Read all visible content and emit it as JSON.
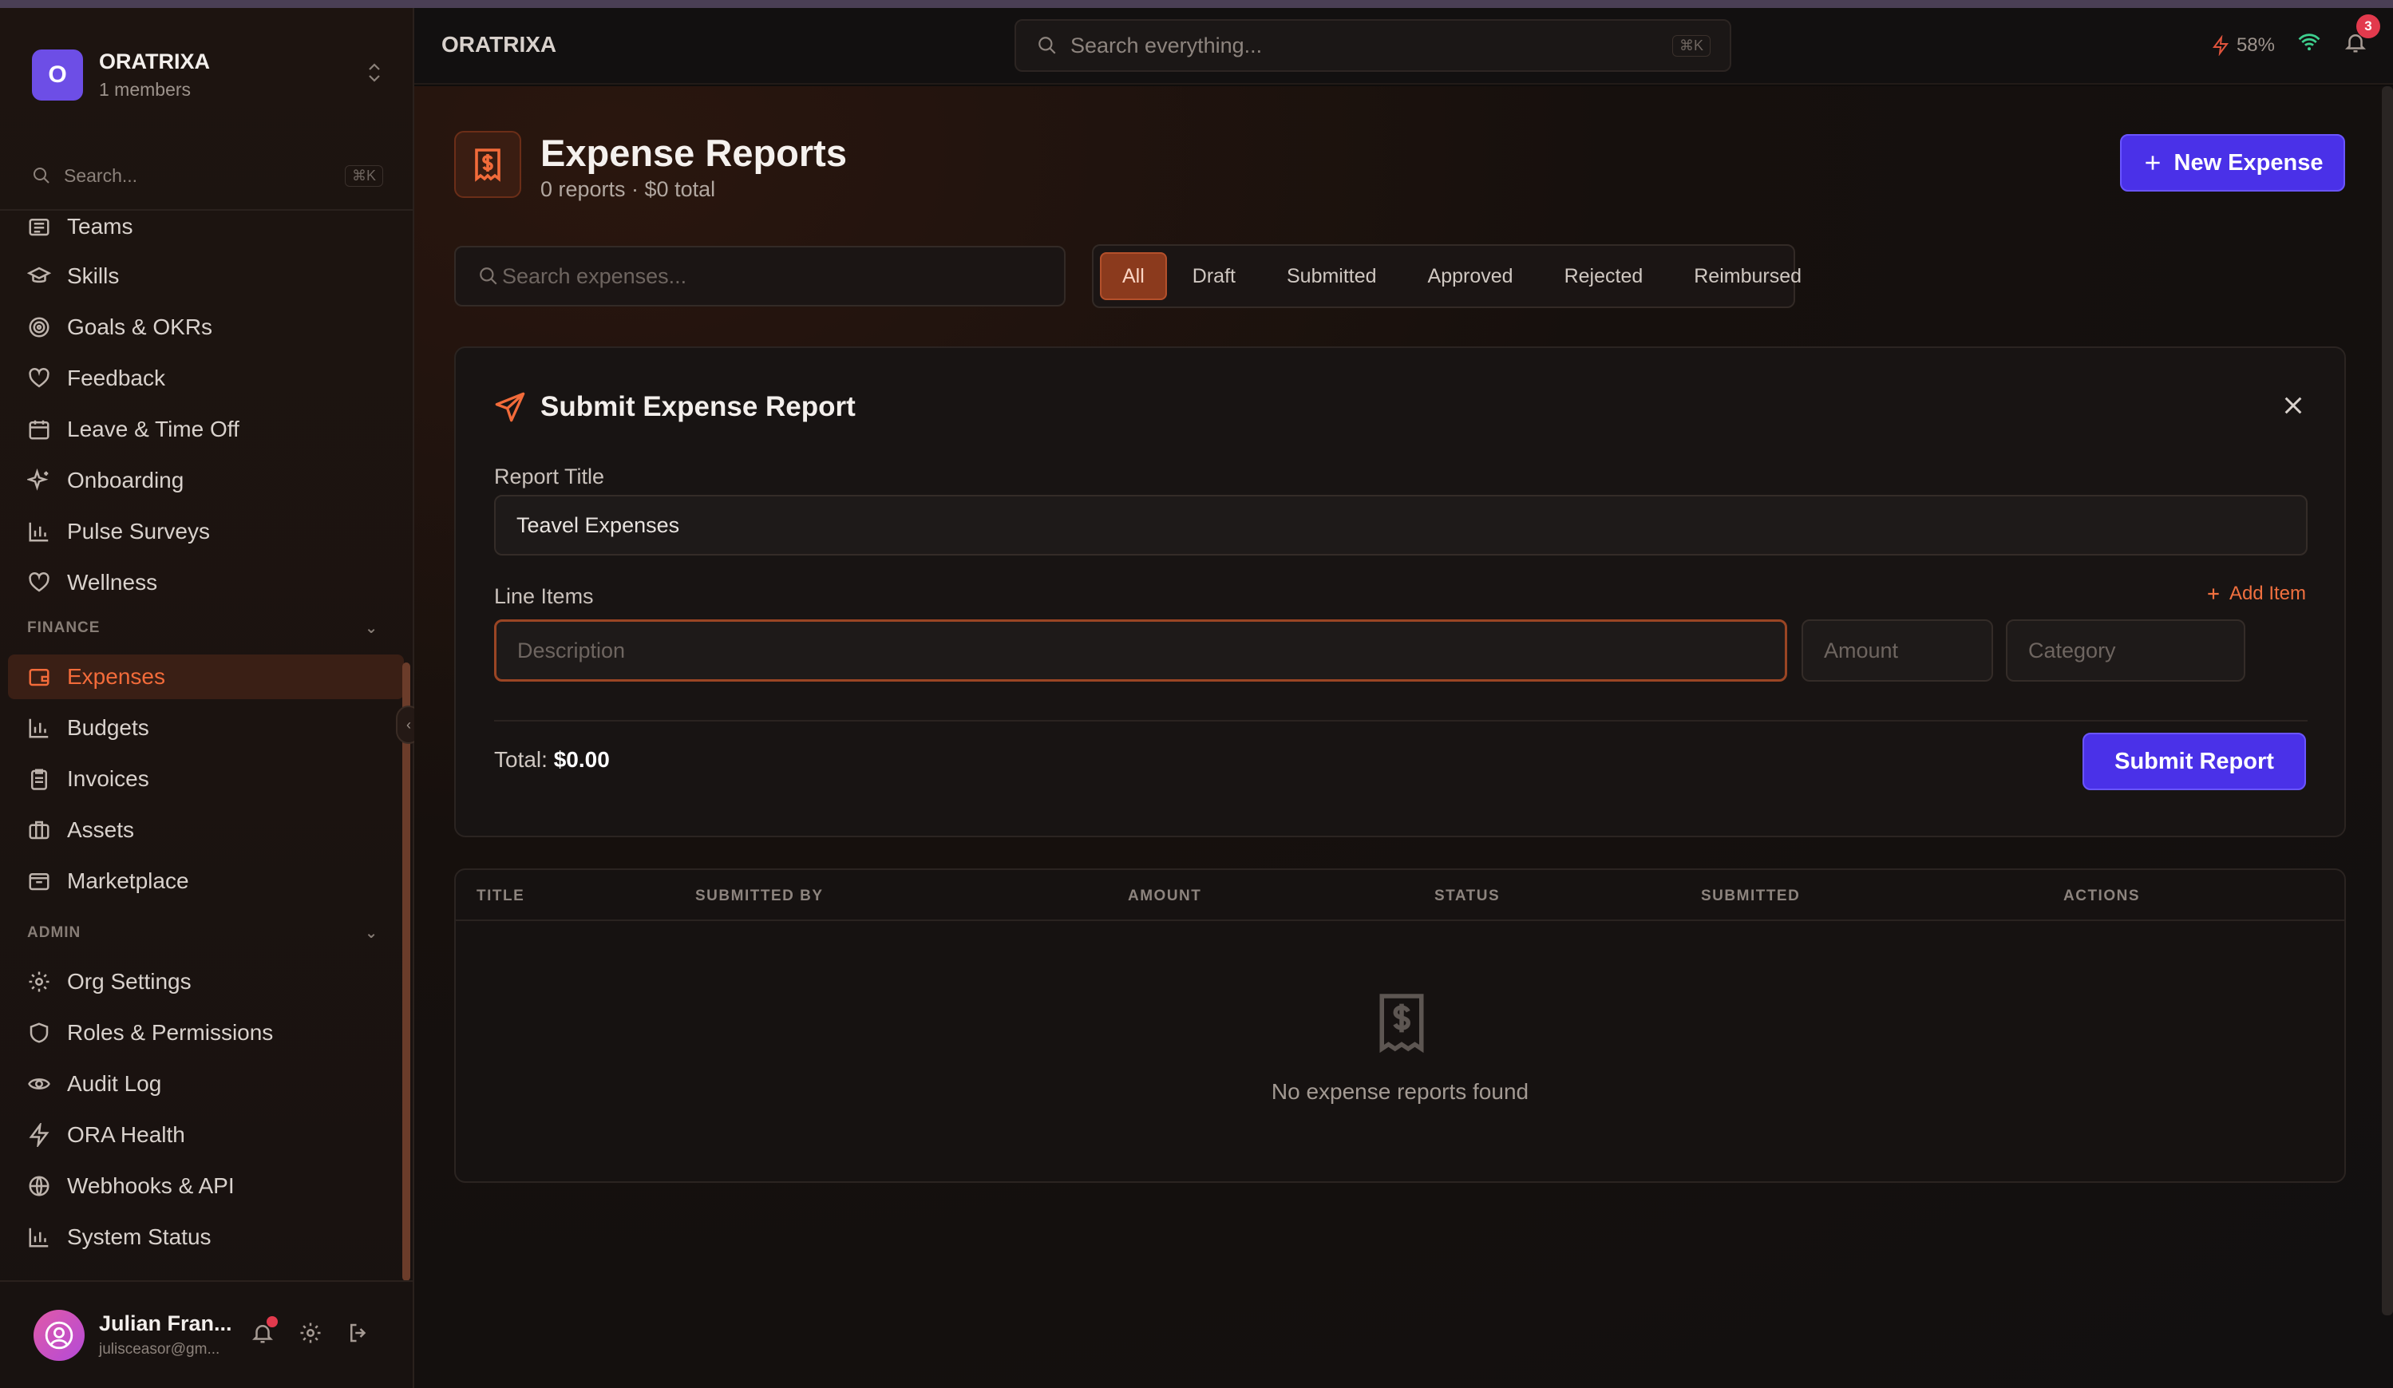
{
  "org": {
    "initial": "O",
    "name": "ORATRIXA",
    "members": "1 members"
  },
  "sidebar": {
    "search_placeholder": "Search...",
    "search_shortcut": "⌘K",
    "items": [
      {
        "label": "Teams",
        "icon": "teams-icon"
      },
      {
        "label": "Skills",
        "icon": "graduation-cap-icon"
      },
      {
        "label": "Goals & OKRs",
        "icon": "target-icon"
      },
      {
        "label": "Feedback",
        "icon": "heart-icon"
      },
      {
        "label": "Leave & Time Off",
        "icon": "calendar-icon"
      },
      {
        "label": "Onboarding",
        "icon": "sparkles-icon"
      },
      {
        "label": "Pulse Surveys",
        "icon": "bar-chart-icon"
      },
      {
        "label": "Wellness",
        "icon": "heart-icon"
      }
    ],
    "finance_label": "FINANCE",
    "finance_items": [
      {
        "label": "Expenses",
        "icon": "wallet-icon",
        "active": true
      },
      {
        "label": "Budgets",
        "icon": "bar-chart-icon"
      },
      {
        "label": "Invoices",
        "icon": "clipboard-icon"
      },
      {
        "label": "Assets",
        "icon": "briefcase-icon"
      },
      {
        "label": "Marketplace",
        "icon": "package-icon"
      }
    ],
    "admin_label": "ADMIN",
    "admin_items": [
      {
        "label": "Org Settings",
        "icon": "gear-icon"
      },
      {
        "label": "Roles & Permissions",
        "icon": "shield-icon"
      },
      {
        "label": "Audit Log",
        "icon": "eye-icon"
      },
      {
        "label": "ORA Health",
        "icon": "zap-icon"
      },
      {
        "label": "Webhooks & API",
        "icon": "globe-icon"
      },
      {
        "label": "System Status",
        "icon": "bar-chart-icon"
      }
    ]
  },
  "user": {
    "name": "Julian Fran...",
    "email": "julisceasor@gm..."
  },
  "topbar": {
    "title": "ORATRIXA",
    "search_placeholder": "Search everything...",
    "search_shortcut": "⌘K",
    "battery": "58%",
    "notification_count": "3"
  },
  "page": {
    "title": "Expense Reports",
    "subtitle": "0 reports · $0 total",
    "new_button": "New Expense",
    "filter_placeholder": "Search expenses...",
    "tabs": [
      "All",
      "Draft",
      "Submitted",
      "Approved",
      "Rejected",
      "Reimbursed"
    ],
    "active_tab": "All"
  },
  "form": {
    "title": "Submit Expense Report",
    "report_title_label": "Report Title",
    "report_title_value": "Teavel Expenses",
    "line_items_label": "Line Items",
    "add_item": "Add Item",
    "description_placeholder": "Description",
    "amount_placeholder": "Amount",
    "category_placeholder": "Category",
    "total_label": "Total:",
    "total_value": "$0.00",
    "submit_button": "Submit Report"
  },
  "table": {
    "columns": [
      "TITLE",
      "SUBMITTED BY",
      "AMOUNT",
      "STATUS",
      "SUBMITTED",
      "ACTIONS"
    ],
    "empty_text": "No expense reports found"
  },
  "colors": {
    "accent": "#f26b3a",
    "primary": "#4a31e8",
    "background": "#121010"
  }
}
